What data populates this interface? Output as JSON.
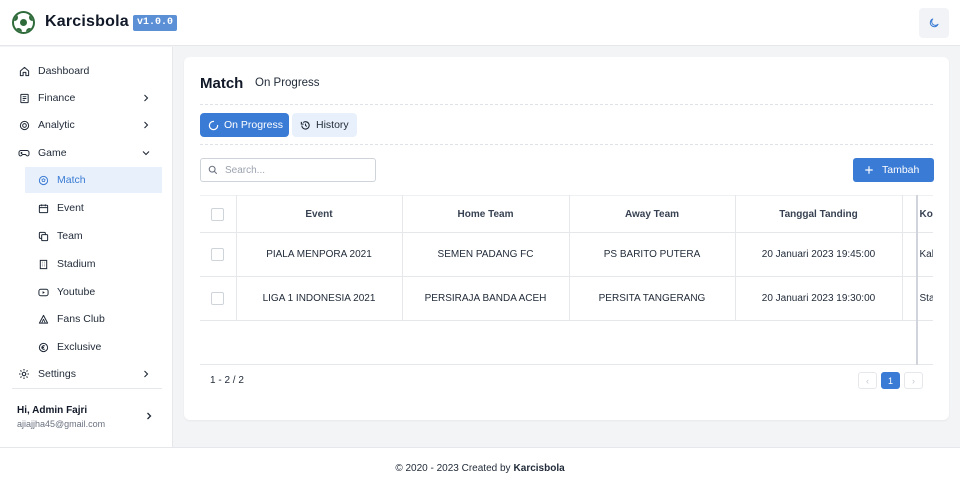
{
  "app": {
    "brand": "Karcisbola",
    "version": "v1.0.0"
  },
  "sidebar": {
    "items": [
      {
        "label": "Dashboard",
        "icon": "home-icon"
      },
      {
        "label": "Finance",
        "icon": "receipt-icon"
      },
      {
        "label": "Analytic",
        "icon": "target-icon"
      },
      {
        "label": "Game",
        "icon": "gamepad-icon"
      },
      {
        "label": "Settings",
        "icon": "gear-icon"
      }
    ],
    "game_sub": [
      {
        "label": "Match",
        "icon": "ball-icon"
      },
      {
        "label": "Event",
        "icon": "calendar-icon"
      },
      {
        "label": "Team",
        "icon": "copy-icon"
      },
      {
        "label": "Stadium",
        "icon": "building-icon"
      },
      {
        "label": "Youtube",
        "icon": "youtube-icon"
      },
      {
        "label": "Fans Club",
        "icon": "fans-icon"
      },
      {
        "label": "Exclusive",
        "icon": "euro-icon"
      }
    ],
    "user": {
      "greeting": "Hi, Admin Fajri",
      "email": "ajiajjha45@gmail.com"
    }
  },
  "page": {
    "title": "Match",
    "subtitle": "On Progress",
    "tabs": [
      {
        "label": "On Progress"
      },
      {
        "label": "History"
      }
    ],
    "search_placeholder": "Search...",
    "add_label": "Tambah"
  },
  "table": {
    "headers": [
      "Event",
      "Home Team",
      "Away Team",
      "Tanggal Tanding",
      "Kota"
    ],
    "rows": [
      [
        "PIALA MENPORA 2021",
        "SEMEN PADANG FC",
        "PS BARITO PUTERA",
        "20 Januari 2023 19:45:00",
        "Kal"
      ],
      [
        "LIGA 1 INDONESIA 2021",
        "PERSIRAJA BANDA ACEH",
        "PERSITA TANGERANG",
        "20 Januari 2023 19:30:00",
        "Sta"
      ]
    ]
  },
  "pagination": {
    "range": "1 - 2 / 2",
    "current": "1",
    "prev": "‹",
    "next": "›"
  },
  "footer": {
    "text": "© 2020 - 2023 Created by",
    "brand": "Karcisbola"
  },
  "colors": {
    "accent": "#3a7bd5",
    "accent_light": "#e8f1fb",
    "version_badge": "#5b8fd6"
  }
}
